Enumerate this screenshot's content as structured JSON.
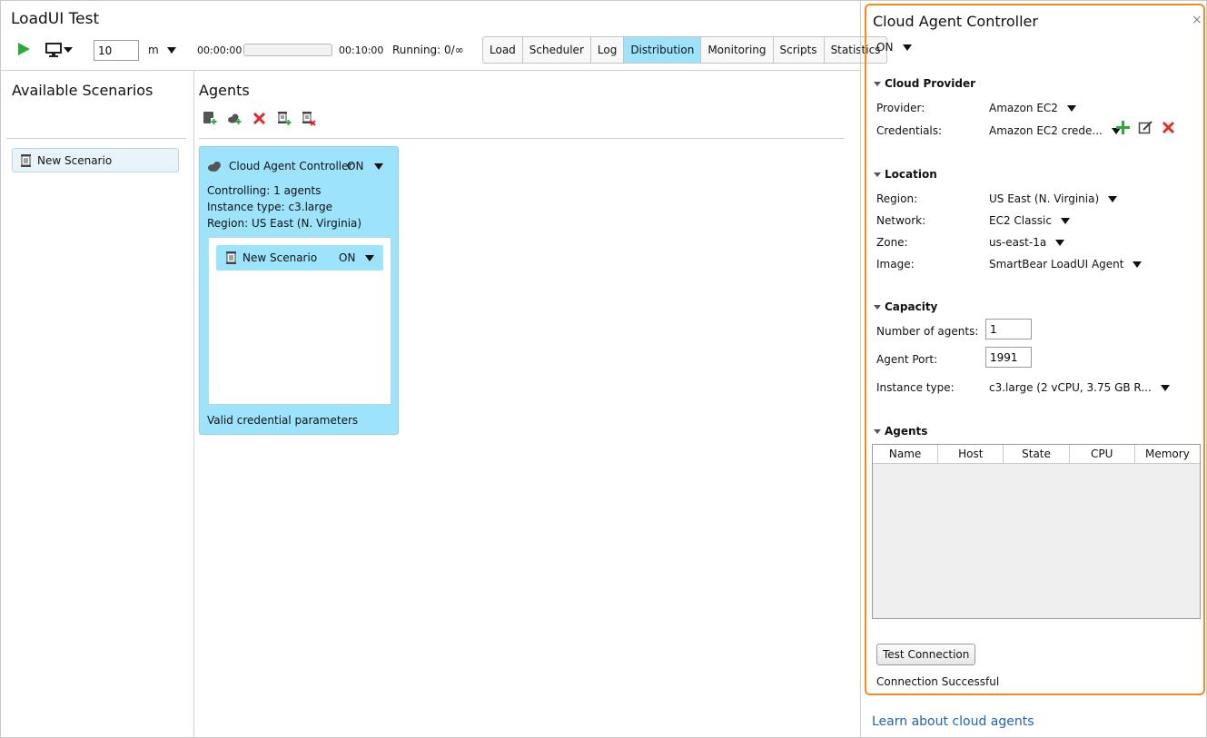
{
  "app": {
    "title": "LoadUI Test"
  },
  "toolbar": {
    "duration_value": "10",
    "duration_unit": "m",
    "time_elapsed": "00:00:00",
    "time_limit": "00:10:00",
    "progress_percent": 0,
    "running": "Running: 0/∞"
  },
  "tabs": [
    "Load",
    "Scheduler",
    "Log",
    "Distribution",
    "Monitoring",
    "Scripts",
    "Statistics"
  ],
  "active_tab": "Distribution",
  "left_panel": {
    "title": "Available Scenarios",
    "scenarios": [
      "New Scenario"
    ]
  },
  "agents_area": {
    "title": "Agents",
    "card": {
      "title": "Cloud Agent Controller",
      "state": "ON",
      "controlling": "Controlling: 1 agents",
      "instance_type": "Instance type: c3.large",
      "region": "Region: US East (N. Virginia)",
      "scenario_label": "New Scenario",
      "scenario_state": "ON",
      "status": "Valid credential parameters"
    }
  },
  "cloud_panel": {
    "title": "Cloud Agent Controller",
    "close": "×",
    "state": "ON",
    "provider_section": {
      "title": "Cloud Provider",
      "provider_label": "Provider:",
      "provider_value": "Amazon EC2",
      "credentials_label": "Credentials:",
      "credentials_value": "Amazon EC2 crede..."
    },
    "location_section": {
      "title": "Location",
      "region_label": "Region:",
      "region_value": "US East (N. Virginia)",
      "network_label": "Network:",
      "network_value": "EC2 Classic",
      "zone_label": "Zone:",
      "zone_value": "us-east-1a",
      "image_label": "Image:",
      "image_value": "SmartBear LoadUI Agent"
    },
    "capacity_section": {
      "title": "Capacity",
      "agents_label": "Number of agents:",
      "agents_value": "1",
      "port_label": "Agent Port:",
      "port_value": "1991",
      "instance_label": "Instance type:",
      "instance_value": "c3.large (2 vCPU, 3.75 GB R..."
    },
    "agents_section": {
      "title": "Agents",
      "columns": [
        "Name",
        "Host",
        "State",
        "CPU",
        "Memory"
      ]
    },
    "test_button": "Test Connection",
    "connection_status": "Connection Successful"
  },
  "footer_link": "Learn about cloud agents",
  "colors": {
    "accent": "#9de3fb",
    "panel_border": "#f5891f",
    "play_green": "#2eaa3c",
    "delete_red": "#e02b2b",
    "link_blue": "#1f64b5"
  }
}
